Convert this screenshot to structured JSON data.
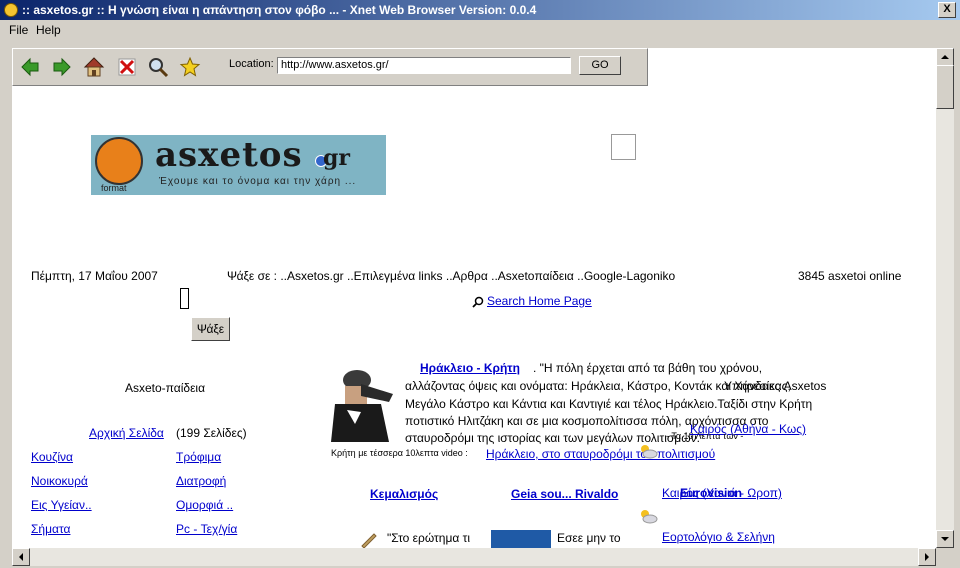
{
  "window": {
    "title": ":: asxetos.gr :: Η γνώση είναι η απάντηση στον φόβο ... - Xnet Web Browser Version: 0.0.4",
    "close_label": "X"
  },
  "menu": {
    "file": "File",
    "help": "Help"
  },
  "toolbar": {
    "location_label": "Location:",
    "location_value": "http://www.asxetos.gr/",
    "go_label": "GO",
    "icons": [
      "back-arrow-icon",
      "forward-arrow-icon",
      "home-icon",
      "stop-icon",
      "search-icon",
      "bookmark-star-icon"
    ]
  },
  "page": {
    "logo": {
      "word": "asxetos",
      "gr": "gr",
      "slogan": "Έχουμε και το όνομα και την χάρη ...",
      "format": "format"
    },
    "date": "Πέμπτη, 17 Μαΐου 2007",
    "search_in": "Ψάξε σε : ..Asxetos.gr ..Επιλεγμένα links ..Αρθρα ..Asxetoπαίδεια ..Google-Lagoniko",
    "online": "3845 asxetoi online",
    "search_button": "Ψάξε",
    "search_home_link": "Search Home Page",
    "asxetopaideia_title": "Asxeto-παίδεια",
    "home_link": "Αρχική Σελίδα",
    "home_pages": "(199 Σελίδες)",
    "left_links": [
      "Κουζίνα",
      "Νοικοκυρά",
      "Εις Υγείαν..",
      "Σήματα"
    ],
    "right_links": [
      "Τρόφιμα",
      "Διατροφή",
      "Ομορφιά ..",
      "Pc - Τεχ/γία"
    ],
    "article": {
      "title_link": "Ηράκλειο - Κρήτη",
      "line1": ". \"Η πόλη έρχεται από τα βάθη του χρόνου,",
      "line2": "αλλάζοντας όψεις και ονόματα: Ηράκλεια, Κάστρο, Κοντάκ και Χάνδακας,",
      "line3": "Μεγάλο Κάστρο και Κάντια και Καντιγιέ και τέλος Ηράκλειο.Ταξίδι στην Κρήτη",
      "line4": "ποτιστικό Ηλιτζάκη και σε μια κοσμοπολίτισσα πόλη, αρχόντισσα στο",
      "line5": "σταυροδρόμι της ιστορίας και των μεγάλων πολιτισμών.\"",
      "caption": "Κρήτη με τέσσερα 10λεπτα video :",
      "caption_link": "Ηράκλειο, στο σταυροδρόμι του πολιτισμού"
    },
    "services_title": "Υπηρεσίες Asxetos",
    "services_small": "- Τα 10 Λεπτά των -",
    "weather1_link": "Καιρός (Αθήνα - Κως)",
    "weather2_link": "Καιρός (Χανιά - Ωροπ)",
    "eurovision_link": "Eurovision",
    "calendar_link": "Εορτολόγιο & Σελήνη",
    "bottom_links": [
      "Κεμαλισμός",
      "Geia sou... Rivaldo"
    ],
    "quote_text": "\"Στο ερώτημα τι",
    "esees_text": "Εσεε μην το"
  }
}
